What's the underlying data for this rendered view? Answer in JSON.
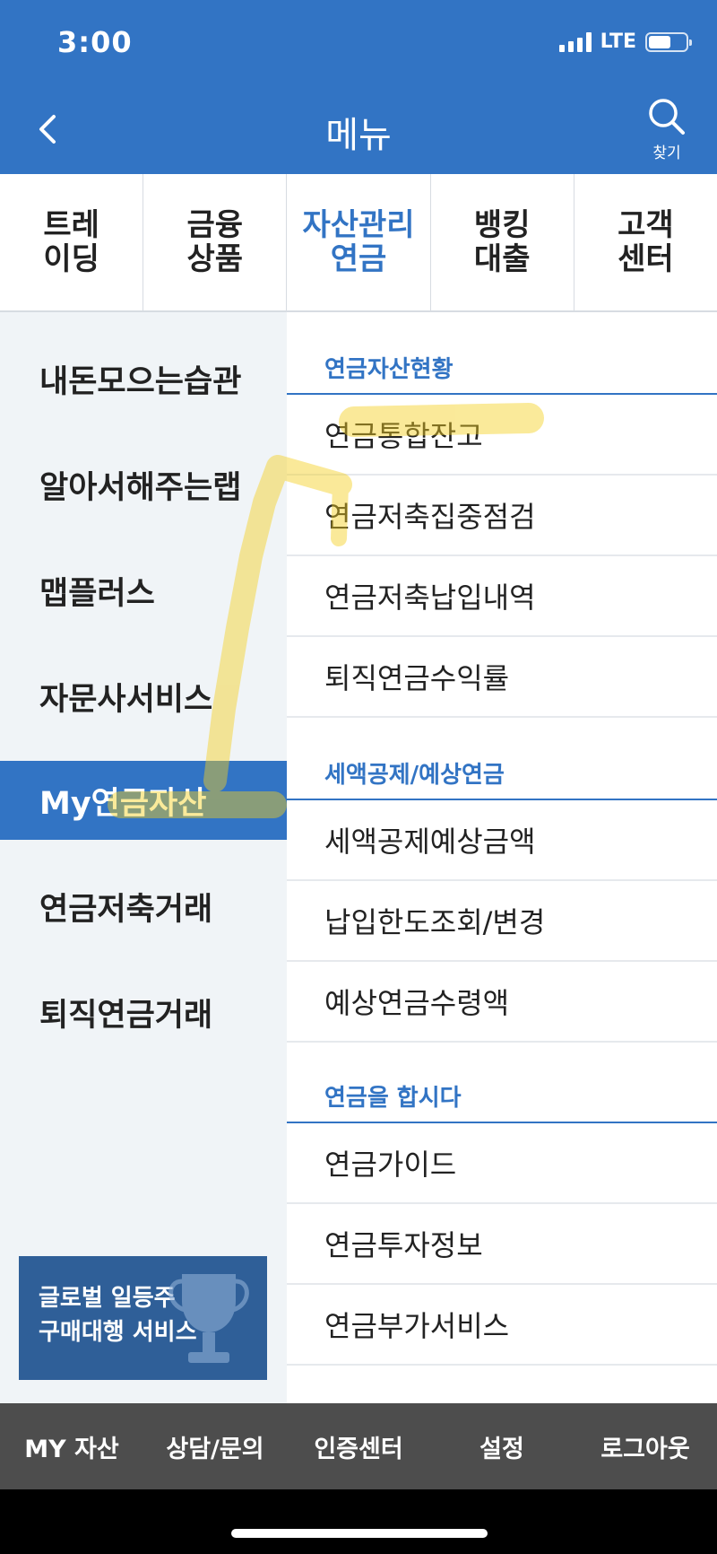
{
  "status": {
    "time": "3:00",
    "network": "LTE",
    "battery_level": 0.6
  },
  "header": {
    "title": "메뉴",
    "search_label": "찾기",
    "back_icon": "chevron-left-icon",
    "search_icon": "search-icon"
  },
  "tabs": [
    {
      "label": "트레\n이딩",
      "active": false
    },
    {
      "label": "금융\n상품",
      "active": false
    },
    {
      "label": "자산관리\n연금",
      "active": true
    },
    {
      "label": "뱅킹\n대출",
      "active": false
    },
    {
      "label": "고객\n센터",
      "active": false
    }
  ],
  "sidebar": {
    "items": [
      {
        "label": "내돈모으는습관"
      },
      {
        "label": "알아서해주는랩"
      },
      {
        "label": "맵플러스"
      },
      {
        "label": "자문사서비스"
      },
      {
        "label": "My연금자산",
        "active": true
      },
      {
        "label": "연금저축거래"
      },
      {
        "label": "퇴직연금거래"
      }
    ],
    "promo": {
      "line1": "글로벌 일등주",
      "line2": "구매대행 서비스"
    }
  },
  "menu": {
    "sections": [
      {
        "title": "연금자산현황",
        "items": [
          "연금통합잔고",
          "연금저축집중점검",
          "연금저축납입내역",
          "퇴직연금수익률"
        ]
      },
      {
        "title": "세액공제/예상연금",
        "items": [
          "세액공제예상금액",
          "납입한도조회/변경",
          "예상연금수령액"
        ]
      },
      {
        "title": "연금을 합시다",
        "items": [
          "연금가이드",
          "연금투자정보",
          "연금부가서비스"
        ]
      }
    ]
  },
  "bottom_nav": [
    "MY 자산",
    "상담/문의",
    "인증센터",
    "설정",
    "로그아웃"
  ],
  "colors": {
    "primary": "#3274c4",
    "sidebar_bg": "#f0f4f7",
    "bottom_bar": "#4d4d4d",
    "highlighter": "#f5d020"
  }
}
